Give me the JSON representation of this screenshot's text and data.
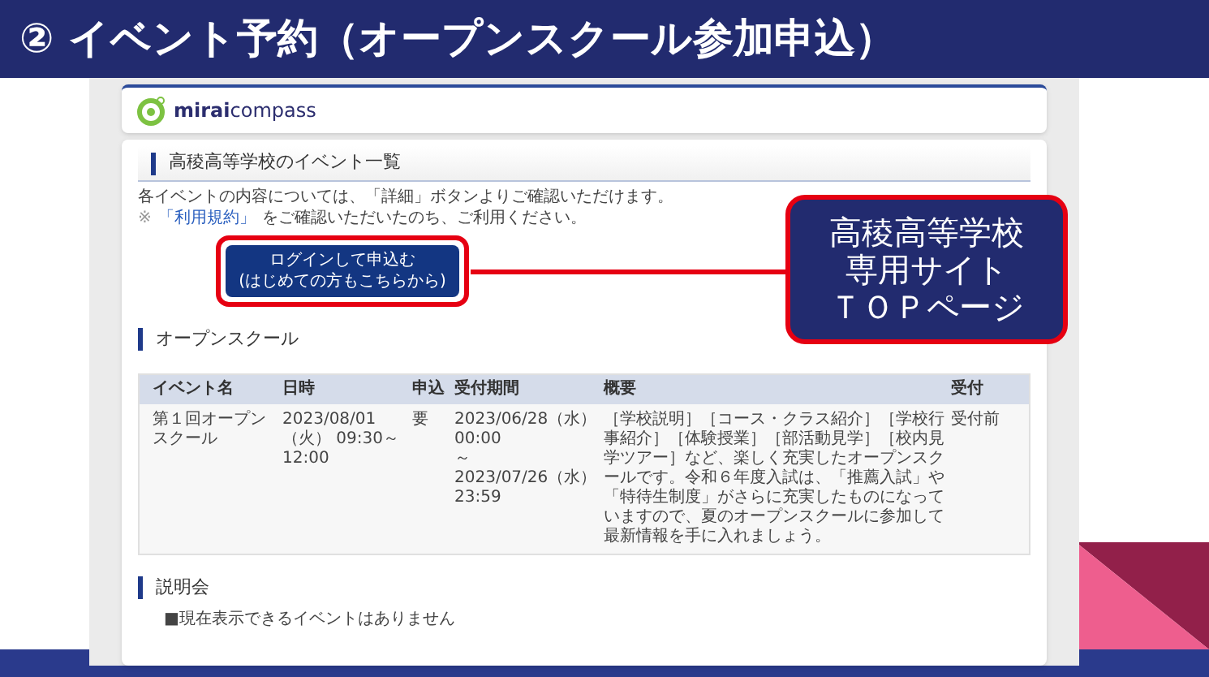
{
  "slide_title": "② イベント予約（オープンスクール参加申込）",
  "logo": "**mirai**compass",
  "page_heading": "高稜高等学校のイベント一覧",
  "intro": {
    "line_1": "各イベントの内容については、「詳細」ボタンよりご確認いただけます。",
    "note_mark": "※",
    "terms_link": "「利用規約」",
    "line_2_rest": "をご確認いただいたのち、ご利用ください。"
  },
  "login_button": [
    "ログインして申込む",
    "(はじめての方もこちらから)"
  ],
  "sections": [
    {
      "kind": "table",
      "title": "オープンスクール",
      "columns": [
        "イベント名",
        "日時",
        "申込",
        "受付期間",
        "概要",
        "受付"
      ],
      "rows": [
        [
          "第１回オープンスクール",
          "2023/08/01（火） 09:30～12:00",
          "要",
          [
            "2023/06/28（水） 00:00",
            "～",
            "2023/07/26（水） 23:59"
          ],
          "［学校説明］［コース・クラス紹介］［学校行事紹介］［体験授業］［部活動見学］［校内見学ツアー］など、楽しく充実したオープンスクールです。令和６年度入試は、「推薦入試」や「特待生制度」がさらに充実したものになっていますので、夏のオープンスクールに参加して最新情報を手に入れましょう。",
          "受付前"
        ]
      ]
    },
    {
      "kind": "empty",
      "title": "説明会",
      "message": "■現在表示できるイベントはありません"
    }
  ],
  "callout": [
    "高稜高等学校",
    "専用サイト",
    "ＴＯＰページ"
  ]
}
